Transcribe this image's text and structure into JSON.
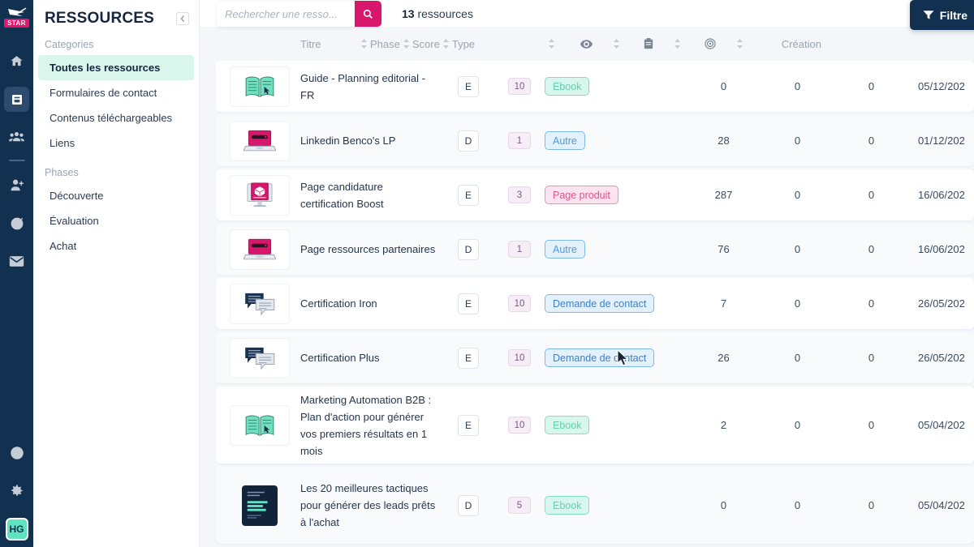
{
  "rail": {
    "logo_label": "STAR",
    "items": [
      {
        "name": "home-icon",
        "label": "Accueil"
      },
      {
        "name": "resources-icon",
        "label": "Ressources",
        "active": true
      },
      {
        "name": "contacts-icon",
        "label": "Contacts"
      },
      {
        "name": "add-user-icon",
        "label": "Ajouter un contact"
      },
      {
        "name": "target-icon",
        "label": "Campagnes"
      },
      {
        "name": "mail-icon",
        "label": "Emails"
      }
    ],
    "bottom": [
      {
        "name": "help-icon",
        "label": "Aide"
      },
      {
        "name": "gear-icon",
        "label": "Paramètres"
      }
    ],
    "avatar_initials": "HG"
  },
  "sidebar": {
    "title": "RESSOURCES",
    "collapse_label": "Réduire",
    "groups": [
      {
        "label": "Categories",
        "items": [
          {
            "label": "Toutes les ressources",
            "active": true
          },
          {
            "label": "Formulaires de contact",
            "active": false
          },
          {
            "label": "Contenus téléchargeables",
            "active": false
          },
          {
            "label": "Liens",
            "active": false
          }
        ]
      },
      {
        "label": "Phases",
        "items": [
          {
            "label": "Découverte",
            "active": false
          },
          {
            "label": "Évaluation",
            "active": false
          },
          {
            "label": "Achat",
            "active": false
          }
        ]
      }
    ]
  },
  "topbar": {
    "search_placeholder": "Rechercher une resso...",
    "search_value": "",
    "search_icon": "search-icon",
    "count_number": "13",
    "count_label": "ressources",
    "filter_label": "Filtre",
    "filter_icon": "funnel-icon",
    "accent_pink": "#d6176c",
    "accent_navy": "#12304f"
  },
  "table": {
    "headers": {
      "title": "Titre",
      "phase": "Phase",
      "score": "Score",
      "type": "Type",
      "views_icon": "eye-icon",
      "forms_icon": "clipboard-icon",
      "conversions_icon": "target-icon",
      "creation": "Création"
    },
    "rows": [
      {
        "thumb": "open-book-icon",
        "title": "Guide - Planning editorial - FR",
        "phase": "E",
        "score": "10",
        "type": "Ebook",
        "type_style": "t-ebook",
        "views": "0",
        "forms": "0",
        "conversions": "0",
        "creation": "05/12/202"
      },
      {
        "thumb": "laptop-icon",
        "title": "Linkedin Benco's LP",
        "phase": "D",
        "score": "1",
        "type": "Autre",
        "type_style": "t-autre",
        "views": "28",
        "forms": "0",
        "conversions": "0",
        "creation": "01/12/202"
      },
      {
        "thumb": "monitor-box-icon",
        "title": "Page candidature certification Boost",
        "phase": "E",
        "score": "3",
        "type": "Page produit",
        "type_style": "t-page",
        "views": "287",
        "forms": "0",
        "conversions": "0",
        "creation": "16/06/202"
      },
      {
        "thumb": "laptop-icon",
        "title": "Page ressources partenaires",
        "phase": "D",
        "score": "1",
        "type": "Autre",
        "type_style": "t-autre",
        "views": "76",
        "forms": "0",
        "conversions": "0",
        "creation": "16/06/202"
      },
      {
        "thumb": "chat-bubbles-icon",
        "title": "Certification Iron",
        "phase": "E",
        "score": "10",
        "type": "Demande de contact",
        "type_style": "t-contact",
        "views": "7",
        "forms": "0",
        "conversions": "0",
        "creation": "26/05/202"
      },
      {
        "thumb": "chat-bubbles-icon",
        "title": "Certification Plus",
        "phase": "E",
        "score": "10",
        "type": "Demande de contact",
        "type_style": "t-contact",
        "views": "26",
        "forms": "0",
        "conversions": "0",
        "creation": "26/05/202"
      },
      {
        "thumb": "open-book-icon",
        "title": "Marketing Automation B2B : Plan d'action pour générer vos premiers résultats en 1 mois",
        "phase": "E",
        "score": "10",
        "type": "Ebook",
        "type_style": "t-ebook",
        "views": "2",
        "forms": "0",
        "conversions": "0",
        "creation": "05/04/202"
      },
      {
        "thumb": "dark-cover-icon",
        "title": "Les 20 meilleures tactiques pour générer des leads prêts à l'achat",
        "phase": "D",
        "score": "5",
        "type": "Ebook",
        "type_style": "t-ebook",
        "views": "0",
        "forms": "0",
        "conversions": "0",
        "creation": "05/04/202"
      }
    ]
  }
}
